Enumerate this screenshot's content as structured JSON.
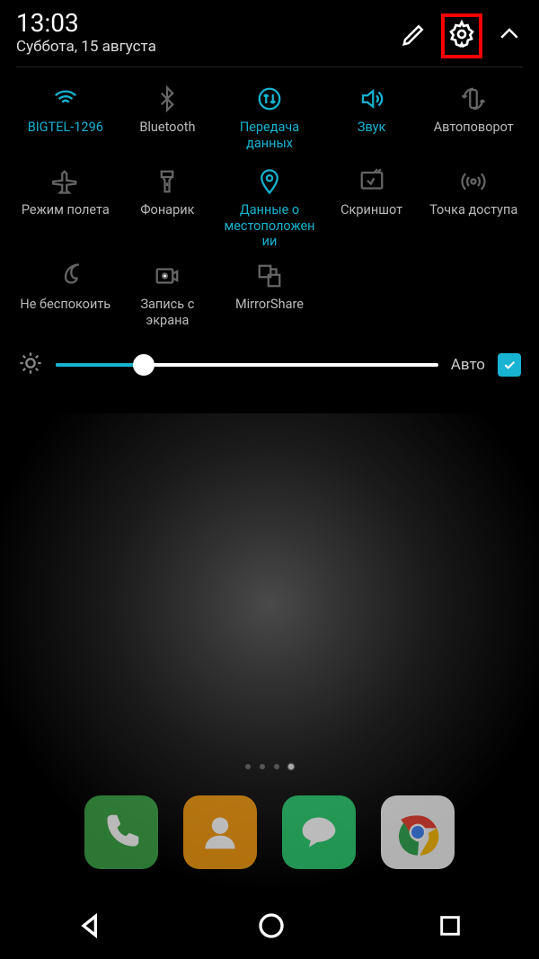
{
  "header": {
    "time": "13:03",
    "date": "Суббота, 15 августа"
  },
  "toggles": [
    {
      "name": "wifi",
      "label": "BIGTEL-1296",
      "active": true
    },
    {
      "name": "bluetooth",
      "label": "Bluetooth",
      "active": false
    },
    {
      "name": "data",
      "label": "Передача данных",
      "active": true
    },
    {
      "name": "sound",
      "label": "Звук",
      "active": true
    },
    {
      "name": "autorotate",
      "label": "Автоповорот",
      "active": false
    },
    {
      "name": "airplane",
      "label": "Режим полета",
      "active": false
    },
    {
      "name": "flashlight",
      "label": "Фонарик",
      "active": false
    },
    {
      "name": "location",
      "label": "Данные о местоположении",
      "active": true
    },
    {
      "name": "screenshot",
      "label": "Скриншот",
      "active": false
    },
    {
      "name": "hotspot",
      "label": "Точка доступа",
      "active": false
    },
    {
      "name": "dnd",
      "label": "Не беспокоить",
      "active": false
    },
    {
      "name": "screenrec",
      "label": "Запись с экрана",
      "active": false
    },
    {
      "name": "mirrorshare",
      "label": "MirrorShare",
      "active": false
    }
  ],
  "brightness": {
    "percent": 23,
    "auto_label": "Авто",
    "auto_checked": true
  }
}
